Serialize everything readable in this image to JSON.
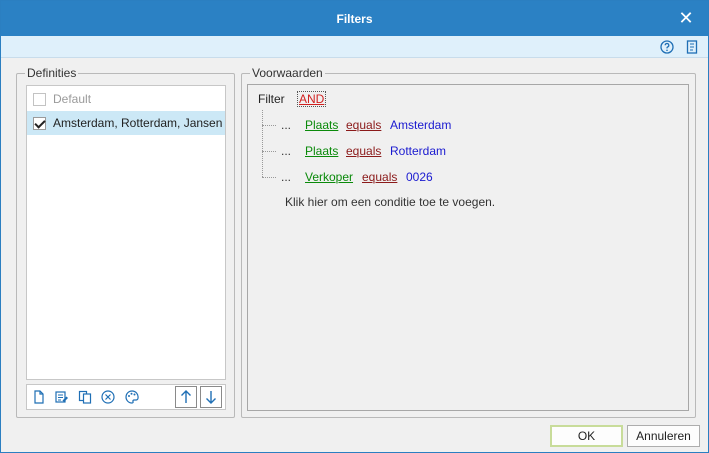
{
  "window": {
    "title": "Filters",
    "accent": "#2b81c4"
  },
  "toolstrip": {
    "icons": [
      "help-icon",
      "document-icon"
    ]
  },
  "definitions": {
    "legend": "Definities",
    "items": [
      {
        "label": "Default",
        "checked": false,
        "disabled": true
      },
      {
        "label": "Amsterdam, Rotterdam, Jansen",
        "checked": true,
        "selected": true
      }
    ],
    "toolbar_icons": [
      "new-document-icon",
      "edit-icon",
      "copy-icon",
      "delete-icon",
      "palette-icon",
      "arrow-up-icon",
      "arrow-down-icon"
    ]
  },
  "conditions": {
    "legend": "Voorwaarden",
    "filter_label": "Filter",
    "operator": "AND",
    "rows": [
      {
        "dots": "...",
        "field": "Plaats",
        "comparator": "equals",
        "value": "Amsterdam"
      },
      {
        "dots": "...",
        "field": "Plaats",
        "comparator": "equals",
        "value": "Rotterdam"
      },
      {
        "dots": "...",
        "field": "Verkoper",
        "comparator": "equals",
        "value": "0026"
      }
    ],
    "add_hint": "Klik hier om een conditie toe te voegen."
  },
  "buttons": {
    "ok": "OK",
    "cancel": "Annuleren"
  },
  "colors": {
    "field": "#0a8a0a",
    "comparator": "#8b1a1a",
    "value": "#1a1ad0",
    "operator": "#d11f1f"
  }
}
